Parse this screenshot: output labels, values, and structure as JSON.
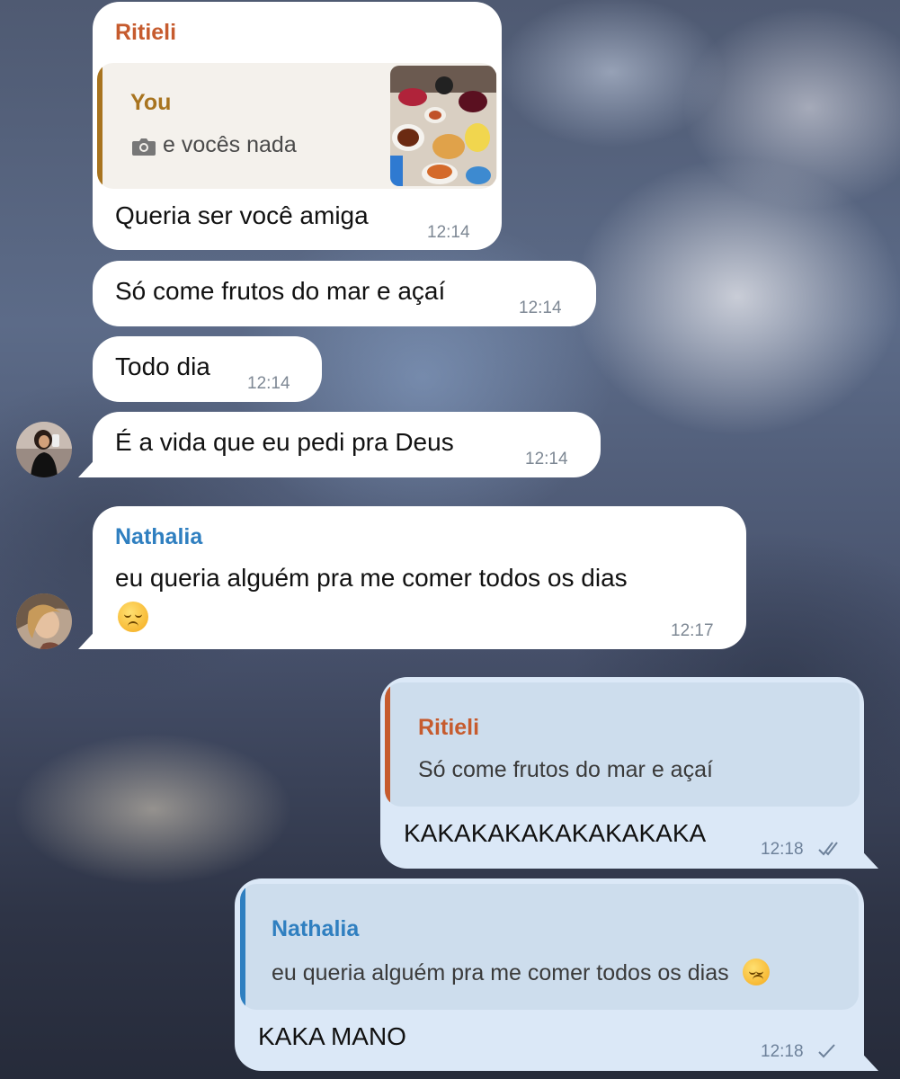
{
  "colors": {
    "incoming_bubble": "#ffffff",
    "outgoing_bubble": "#dbe8f7",
    "ritieli_name": "#c65b2e",
    "nathalia_name": "#2f7fc0",
    "you_name": "#a8741f",
    "timestamp": "#7e8894"
  },
  "messages": [
    {
      "sender": "Ritieli",
      "reply": {
        "name": "You",
        "icon": "camera-icon",
        "text": "e vocês nada",
        "has_thumbnail": true
      },
      "text": "Queria ser você amiga",
      "time": "12:14"
    },
    {
      "text": "Só come frutos do mar e açaí",
      "time": "12:14"
    },
    {
      "text": "Todo dia",
      "time": "12:14"
    },
    {
      "text": "É a vida que eu pedi pra Deus",
      "time": "12:14"
    },
    {
      "sender": "Nathalia",
      "text": "eu queria alguém pra me comer todos os dias",
      "emoji": "pensive-face-emoji",
      "time": "12:17"
    },
    {
      "reply": {
        "name": "Ritieli",
        "text": "Só come frutos do mar e açaí"
      },
      "text": "KAKAKAKAKAKAKAKAKA",
      "time": "12:18",
      "status": "read"
    },
    {
      "reply": {
        "name": "Nathalia",
        "text": "eu queria alguém pra me comer todos os dias",
        "emoji": "pensive-face-emoji"
      },
      "text": "KAKA MANO",
      "time": "12:18",
      "status": "sent"
    }
  ]
}
